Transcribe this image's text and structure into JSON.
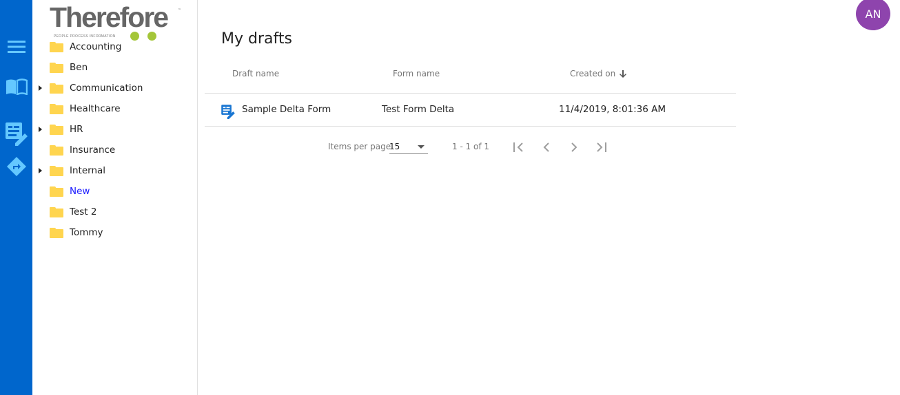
{
  "brand": {
    "name": "Therefore",
    "tagline": "PEOPLE  PROCESS  INFORMATION",
    "trademark": "™",
    "colors": {
      "rail": "#0066cc",
      "logo_text": "#666666",
      "logo_dots": "#a4c639",
      "folder": "#ffd54f",
      "active_link": "#1a1aff",
      "avatar": "#8e44ad"
    }
  },
  "rail": {
    "items": [
      {
        "name": "menu",
        "icon": "hamburger-menu-icon"
      },
      {
        "name": "library",
        "icon": "open-book-icon"
      },
      {
        "name": "drafts",
        "icon": "form-edit-icon"
      },
      {
        "name": "workflow",
        "icon": "directions-sign-icon"
      }
    ]
  },
  "tree": {
    "items": [
      {
        "label": "Accounting",
        "expandable": false,
        "active": false
      },
      {
        "label": "Ben",
        "expandable": false,
        "active": false
      },
      {
        "label": "Communication",
        "expandable": true,
        "active": false
      },
      {
        "label": "Healthcare",
        "expandable": false,
        "active": false
      },
      {
        "label": "HR",
        "expandable": true,
        "active": false
      },
      {
        "label": "Insurance",
        "expandable": false,
        "active": false
      },
      {
        "label": "Internal",
        "expandable": true,
        "active": false
      },
      {
        "label": "New",
        "expandable": false,
        "active": true
      },
      {
        "label": "Test 2",
        "expandable": false,
        "active": false
      },
      {
        "label": "Tommy",
        "expandable": false,
        "active": false
      }
    ]
  },
  "main": {
    "title": "My drafts",
    "table": {
      "columns": [
        {
          "label": "Draft name"
        },
        {
          "label": "Form name"
        },
        {
          "label": "Created on",
          "sort": "descending"
        }
      ],
      "rows": [
        {
          "icon": "form-edit-icon",
          "draft_name": "Sample Delta Form",
          "form_name": "Test Form Delta",
          "created_on": "11/4/2019, 8:01:36 AM"
        }
      ]
    },
    "paginator": {
      "items_per_page_label": "Items per page",
      "items_per_page": "15",
      "range": "1 - 1 of 1",
      "buttons": [
        "first-page",
        "previous-page",
        "next-page",
        "last-page"
      ]
    }
  },
  "user": {
    "initials": "AN"
  }
}
